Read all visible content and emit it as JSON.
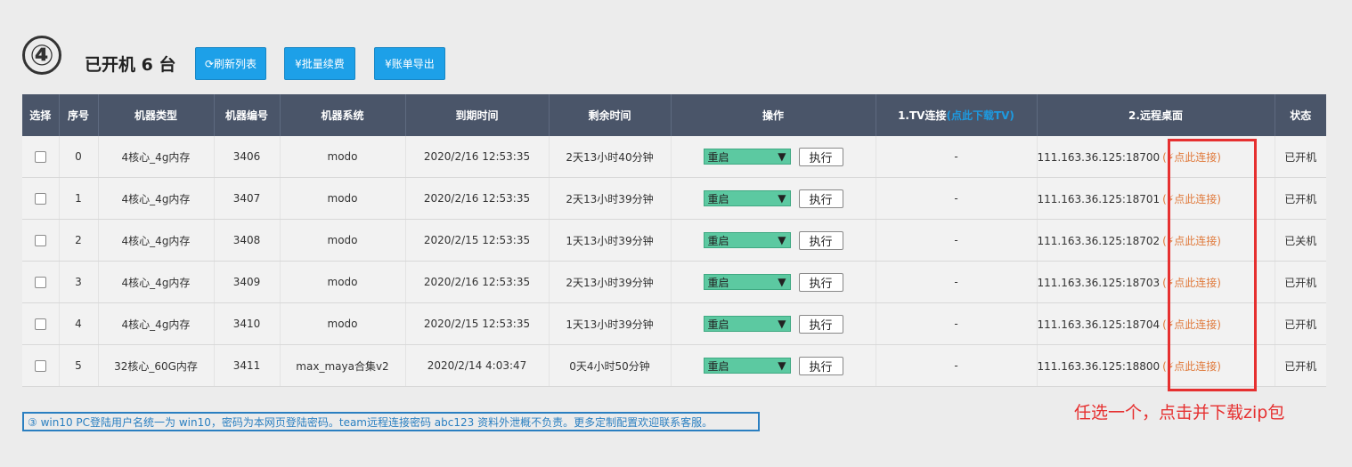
{
  "step_number": "④",
  "heading": "已开机 6 台",
  "toolbar": {
    "refresh_label": "⟳刷新列表",
    "renew_label": "¥批量续费",
    "export_label": "¥账单导出"
  },
  "table": {
    "headers": {
      "select": "选择",
      "index": "序号",
      "type": "机器类型",
      "number": "机器编号",
      "system": "机器系统",
      "expiry": "到期时间",
      "remaining": "剩余时间",
      "operation": "操作",
      "tv_prefix": "1.TV连接",
      "tv_link": "(点此下载TV)",
      "remote": "2.远程桌面",
      "status": "状态"
    },
    "rows": [
      {
        "index": "0",
        "type": "4核心_4g内存",
        "number": "3406",
        "system": "modo",
        "expiry": "2020/2/16 12:53:35",
        "remaining": "2天13小时40分钟",
        "action": "重启",
        "exec": "执行",
        "tv": "-",
        "remote": "111.163.36.125:18700",
        "connect": "(⚡点此连接)",
        "status": "已开机"
      },
      {
        "index": "1",
        "type": "4核心_4g内存",
        "number": "3407",
        "system": "modo",
        "expiry": "2020/2/16 12:53:35",
        "remaining": "2天13小时39分钟",
        "action": "重启",
        "exec": "执行",
        "tv": "-",
        "remote": "111.163.36.125:18701",
        "connect": "(⚡点此连接)",
        "status": "已开机"
      },
      {
        "index": "2",
        "type": "4核心_4g内存",
        "number": "3408",
        "system": "modo",
        "expiry": "2020/2/15 12:53:35",
        "remaining": "1天13小时39分钟",
        "action": "重启",
        "exec": "执行",
        "tv": "-",
        "remote": "111.163.36.125:18702",
        "connect": "(⚡点此连接)",
        "status": "已关机"
      },
      {
        "index": "3",
        "type": "4核心_4g内存",
        "number": "3409",
        "system": "modo",
        "expiry": "2020/2/16 12:53:35",
        "remaining": "2天13小时39分钟",
        "action": "重启",
        "exec": "执行",
        "tv": "-",
        "remote": "111.163.36.125:18703",
        "connect": "(⚡点此连接)",
        "status": "已开机"
      },
      {
        "index": "4",
        "type": "4核心_4g内存",
        "number": "3410",
        "system": "modo",
        "expiry": "2020/2/15 12:53:35",
        "remaining": "1天13小时39分钟",
        "action": "重启",
        "exec": "执行",
        "tv": "-",
        "remote": "111.163.36.125:18704",
        "connect": "(⚡点此连接)",
        "status": "已开机"
      },
      {
        "index": "5",
        "type": "32核心_60G内存",
        "number": "3411",
        "system": "max_maya合集v2",
        "expiry": "2020/2/14 4:03:47",
        "remaining": "0天4小时50分钟",
        "action": "重启",
        "exec": "执行",
        "tv": "-",
        "remote": "111.163.36.125:18800",
        "connect": "(⚡点此连接)",
        "status": "已开机"
      }
    ]
  },
  "annotation": "任选一个，点击并下载zip包",
  "footnote": "③ win10 PC登陆用户名统一为 win10，密码为本网页登陆密码。team远程连接密码 abc123 资料外泄概不负责。更多定制配置欢迎联系客服。",
  "colors": {
    "header_bg": "#4a5569",
    "button_bg": "#1da0e8",
    "select_bg": "#5cc9a1",
    "highlight": "#e63030",
    "link": "#1d9ae0",
    "connect": "#e07a3c"
  }
}
